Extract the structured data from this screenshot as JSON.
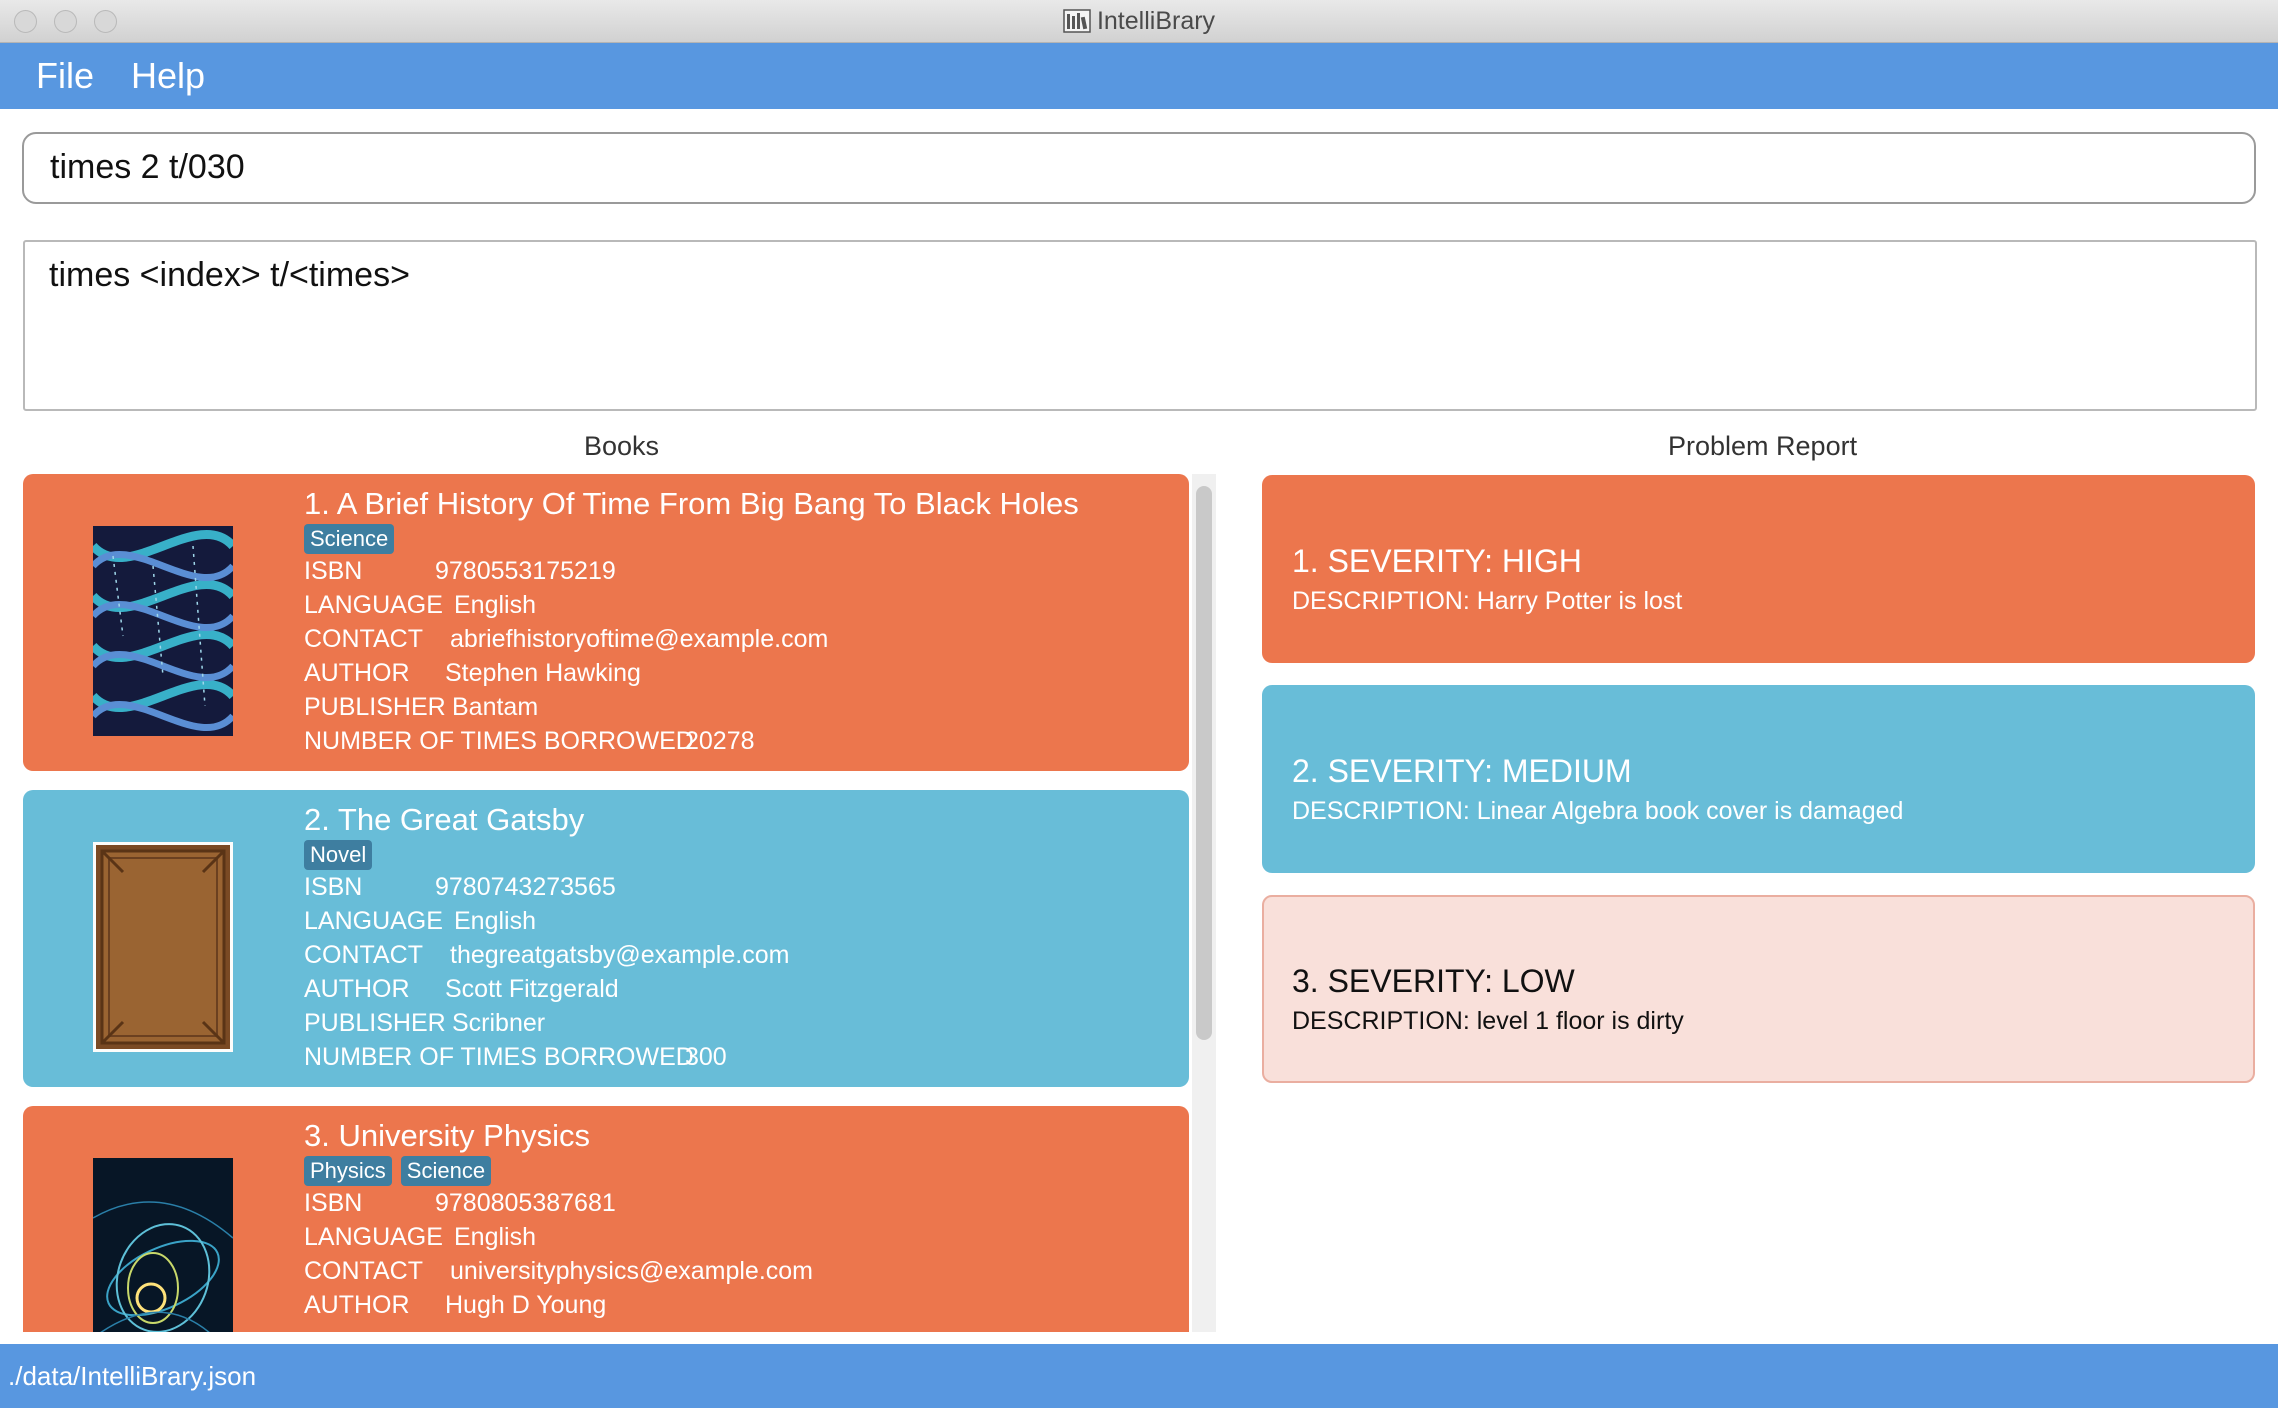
{
  "window": {
    "title": "IntelliBrary"
  },
  "menu": {
    "file": "File",
    "help": "Help"
  },
  "command": {
    "value": "times 2 t/030"
  },
  "result": {
    "text": "times <index> t/<times>"
  },
  "books_panel": {
    "heading": "Books",
    "field_labels": {
      "isbn": "ISBN",
      "language": "LANGUAGE",
      "contact": "CONTACT",
      "author": "AUTHOR",
      "publisher": "PUBLISHER",
      "times_borrowed": "NUMBER OF TIMES BORROWED"
    },
    "books": [
      {
        "title": "1.  A Brief History Of Time From Big Bang To Black Holes",
        "tags": [
          "Science"
        ],
        "isbn": "9780553175219",
        "language": "English",
        "contact": "abriefhistoryoftime@example.com",
        "author": "Stephen Hawking",
        "publisher": "Bantam",
        "times_borrowed": "20278",
        "color": "#ec764d"
      },
      {
        "title": "2.  The Great Gatsby",
        "tags": [
          "Novel"
        ],
        "isbn": "9780743273565",
        "language": "English",
        "contact": "thegreatgatsby@example.com",
        "author": "Scott Fitzgerald",
        "publisher": "Scribner",
        "times_borrowed": "300",
        "color": "#68bdd8"
      },
      {
        "title": "3.  University Physics",
        "tags": [
          "Physics",
          "Science"
        ],
        "isbn": "9780805387681",
        "language": "English",
        "contact": "universityphysics@example.com",
        "author": "Hugh D Young",
        "color": "#ec764d"
      }
    ]
  },
  "problems_panel": {
    "heading": "Problem Report",
    "problems": [
      {
        "severity": "1.  SEVERITY: HIGH",
        "description": "DESCRIPTION: Harry Potter is lost",
        "color": "#ec764d"
      },
      {
        "severity": "2.  SEVERITY: MEDIUM",
        "description": "DESCRIPTION: Linear Algebra book cover is damaged",
        "color": "#68bdd8"
      },
      {
        "severity": "3.  SEVERITY: LOW",
        "description": "DESCRIPTION: level 1 floor is dirty",
        "color": "#f9e0da"
      }
    ]
  },
  "status": {
    "path": "./data/IntelliBrary.json"
  }
}
